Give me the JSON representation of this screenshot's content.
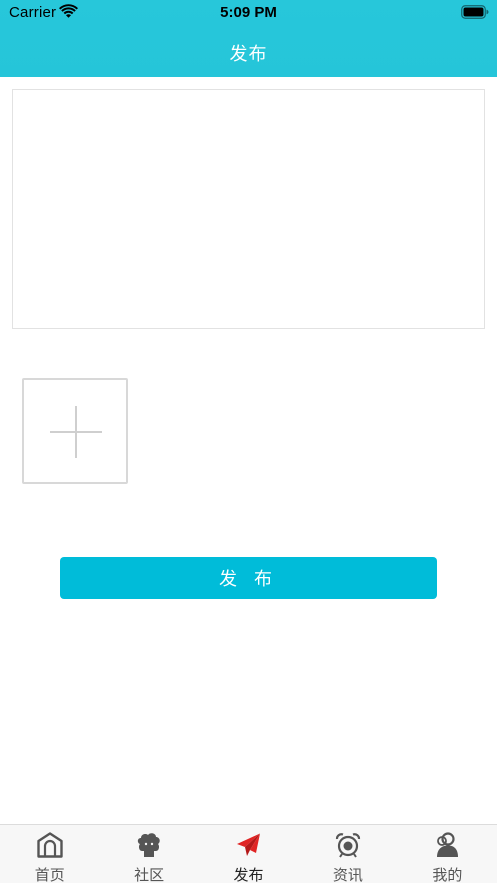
{
  "status_bar": {
    "carrier": "Carrier",
    "time": "5:09 PM"
  },
  "nav": {
    "title": "发布"
  },
  "compose": {
    "text_value": "",
    "add_image_icon": "plus-icon"
  },
  "actions": {
    "publish_label": "发 布"
  },
  "tab_bar": {
    "items": [
      {
        "label": "首页",
        "icon": "home-icon",
        "active": false
      },
      {
        "label": "社区",
        "icon": "community-icon",
        "active": false
      },
      {
        "label": "发布",
        "icon": "paper-plane-icon",
        "active": true
      },
      {
        "label": "资讯",
        "icon": "alarm-clock-icon",
        "active": false
      },
      {
        "label": "我的",
        "icon": "user-icon",
        "active": false
      }
    ]
  },
  "colors": {
    "header": "#26c6da",
    "button": "#00bcd9",
    "active_icon": "#e02424",
    "inactive_icon": "#555555"
  }
}
